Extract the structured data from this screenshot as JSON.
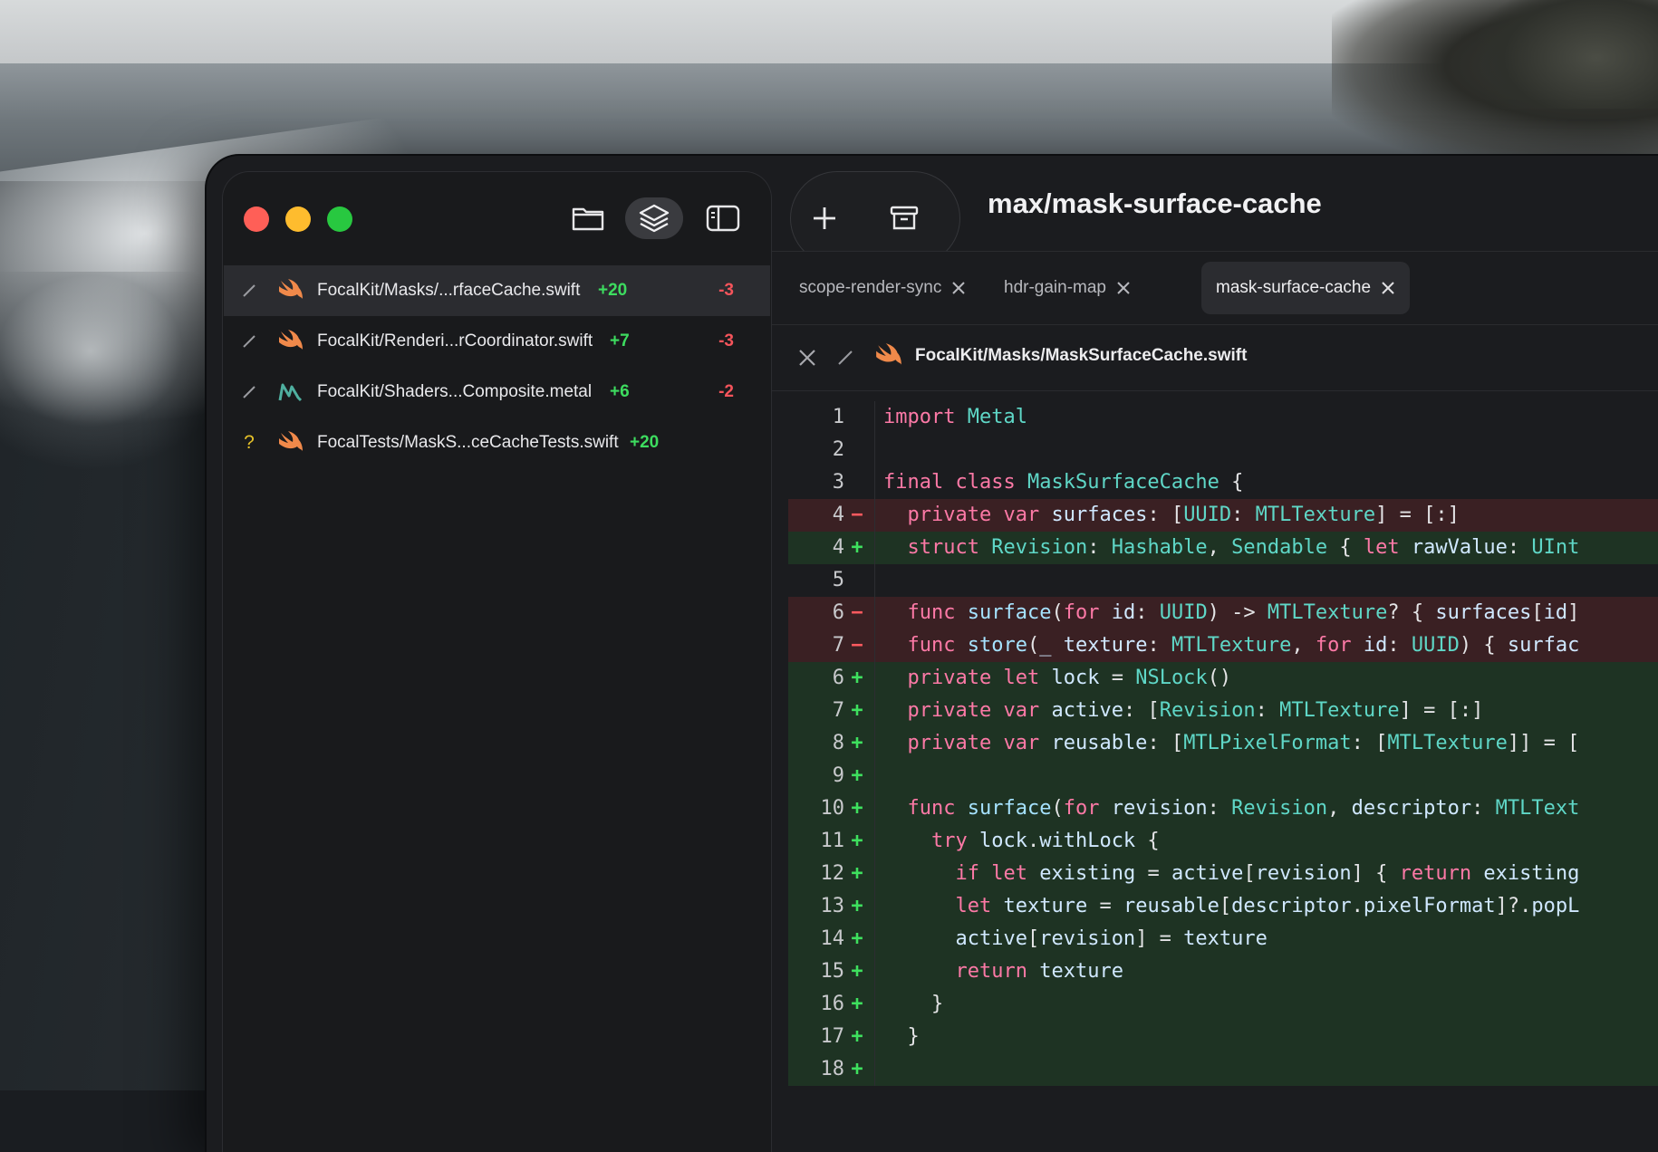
{
  "window": {
    "branch_title": "max/mask-surface-cache",
    "colors": {
      "accent_added": "#3ddc5f",
      "accent_removed": "#f5545b"
    }
  },
  "sidebar": {
    "icons": [
      "folder-icon",
      "layers-icon",
      "sidebar-toggle-icon"
    ],
    "files": [
      {
        "status": "modified",
        "icon": "swift-icon",
        "name": "FocalKit/Masks/...rfaceCache.swift",
        "added": "+20",
        "removed": "-3",
        "selected": true
      },
      {
        "status": "modified",
        "icon": "swift-icon",
        "name": "FocalKit/Renderi...rCoordinator.swift",
        "added": "+7",
        "removed": "-3"
      },
      {
        "status": "modified",
        "icon": "metal-icon",
        "name": "FocalKit/Shaders...Composite.metal",
        "added": "+6",
        "removed": "-2"
      },
      {
        "status": "untracked",
        "status_glyph": "?",
        "icon": "swift-icon",
        "name": "FocalTests/MaskS...ceCacheTests.swift",
        "added": "+20",
        "removed": ""
      }
    ]
  },
  "toolbar": {
    "new_icon": "plus-icon",
    "archive_icon": "archive-icon"
  },
  "tabs": [
    {
      "label": "scope-render-sync"
    },
    {
      "label": "hdr-gain-map"
    },
    {
      "label": "mask-surface-cache",
      "active": true
    }
  ],
  "file_header": {
    "path": "FocalKit/Masks/MaskSurfaceCache.swift"
  },
  "diff": {
    "lines": [
      {
        "n": "1",
        "mark": "",
        "type": "ctx",
        "code": "import Metal"
      },
      {
        "n": "2",
        "mark": "",
        "type": "ctx",
        "code": ""
      },
      {
        "n": "3",
        "mark": "",
        "type": "ctx",
        "code": "final class MaskSurfaceCache {"
      },
      {
        "n": "4",
        "mark": "-",
        "type": "del",
        "code": "  private var surfaces: [UUID: MTLTexture] = [:]"
      },
      {
        "n": "4",
        "mark": "+",
        "type": "add",
        "code": "  struct Revision: Hashable, Sendable { let rawValue: UInt"
      },
      {
        "n": "5",
        "mark": "",
        "type": "ctx",
        "code": ""
      },
      {
        "n": "6",
        "mark": "-",
        "type": "del",
        "code": "  func surface(for id: UUID) -> MTLTexture? { surfaces[id]"
      },
      {
        "n": "7",
        "mark": "-",
        "type": "del",
        "code": "  func store(_ texture: MTLTexture, for id: UUID) { surfac"
      },
      {
        "n": "6",
        "mark": "+",
        "type": "add",
        "code": "  private let lock = NSLock()"
      },
      {
        "n": "7",
        "mark": "+",
        "type": "add",
        "code": "  private var active: [Revision: MTLTexture] = [:]"
      },
      {
        "n": "8",
        "mark": "+",
        "type": "add",
        "code": "  private var reusable: [MTLPixelFormat: [MTLTexture]] = ["
      },
      {
        "n": "9",
        "mark": "+",
        "type": "add",
        "code": ""
      },
      {
        "n": "10",
        "mark": "+",
        "type": "add",
        "code": "  func surface(for revision: Revision, descriptor: MTLText"
      },
      {
        "n": "11",
        "mark": "+",
        "type": "add",
        "code": "    try lock.withLock {"
      },
      {
        "n": "12",
        "mark": "+",
        "type": "add",
        "code": "      if let existing = active[revision] { return existing"
      },
      {
        "n": "13",
        "mark": "+",
        "type": "add",
        "code": "      let texture = reusable[descriptor.pixelFormat]?.popL"
      },
      {
        "n": "14",
        "mark": "+",
        "type": "add",
        "code": "      active[revision] = texture"
      },
      {
        "n": "15",
        "mark": "+",
        "type": "add",
        "code": "      return texture"
      },
      {
        "n": "16",
        "mark": "+",
        "type": "add",
        "code": "    }"
      },
      {
        "n": "17",
        "mark": "+",
        "type": "add",
        "code": "  }"
      },
      {
        "n": "18",
        "mark": "+",
        "type": "add",
        "code": ""
      }
    ]
  }
}
